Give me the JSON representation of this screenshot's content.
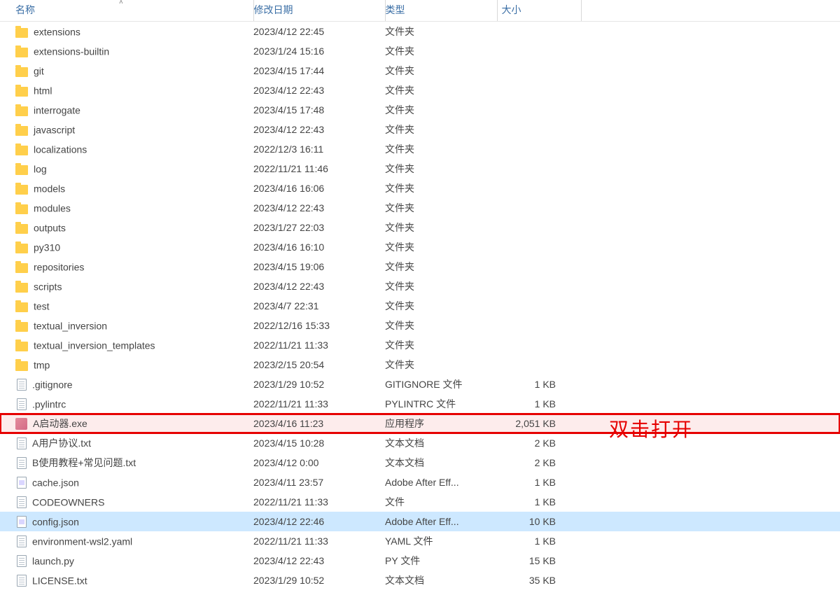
{
  "columns": {
    "name": "名称",
    "date": "修改日期",
    "type": "类型",
    "size": "大小"
  },
  "annotation": "双击打开",
  "files": [
    {
      "icon": "folder",
      "name": "extensions",
      "date": "2023/4/12 22:45",
      "type": "文件夹",
      "size": ""
    },
    {
      "icon": "folder",
      "name": "extensions-builtin",
      "date": "2023/1/24 15:16",
      "type": "文件夹",
      "size": ""
    },
    {
      "icon": "folder",
      "name": "git",
      "date": "2023/4/15 17:44",
      "type": "文件夹",
      "size": ""
    },
    {
      "icon": "folder",
      "name": "html",
      "date": "2023/4/12 22:43",
      "type": "文件夹",
      "size": ""
    },
    {
      "icon": "folder",
      "name": "interrogate",
      "date": "2023/4/15 17:48",
      "type": "文件夹",
      "size": ""
    },
    {
      "icon": "folder",
      "name": "javascript",
      "date": "2023/4/12 22:43",
      "type": "文件夹",
      "size": ""
    },
    {
      "icon": "folder",
      "name": "localizations",
      "date": "2022/12/3 16:11",
      "type": "文件夹",
      "size": ""
    },
    {
      "icon": "folder",
      "name": "log",
      "date": "2022/11/21 11:46",
      "type": "文件夹",
      "size": ""
    },
    {
      "icon": "folder",
      "name": "models",
      "date": "2023/4/16 16:06",
      "type": "文件夹",
      "size": ""
    },
    {
      "icon": "folder",
      "name": "modules",
      "date": "2023/4/12 22:43",
      "type": "文件夹",
      "size": ""
    },
    {
      "icon": "folder",
      "name": "outputs",
      "date": "2023/1/27 22:03",
      "type": "文件夹",
      "size": ""
    },
    {
      "icon": "folder",
      "name": "py310",
      "date": "2023/4/16 16:10",
      "type": "文件夹",
      "size": ""
    },
    {
      "icon": "folder",
      "name": "repositories",
      "date": "2023/4/15 19:06",
      "type": "文件夹",
      "size": ""
    },
    {
      "icon": "folder",
      "name": "scripts",
      "date": "2023/4/12 22:43",
      "type": "文件夹",
      "size": ""
    },
    {
      "icon": "folder",
      "name": "test",
      "date": "2023/4/7 22:31",
      "type": "文件夹",
      "size": ""
    },
    {
      "icon": "folder",
      "name": "textual_inversion",
      "date": "2022/12/16 15:33",
      "type": "文件夹",
      "size": ""
    },
    {
      "icon": "folder",
      "name": "textual_inversion_templates",
      "date": "2022/11/21 11:33",
      "type": "文件夹",
      "size": ""
    },
    {
      "icon": "folder",
      "name": "tmp",
      "date": "2023/2/15 20:54",
      "type": "文件夹",
      "size": ""
    },
    {
      "icon": "file",
      "name": ".gitignore",
      "date": "2023/1/29 10:52",
      "type": "GITIGNORE 文件",
      "size": "1 KB"
    },
    {
      "icon": "file",
      "name": ".pylintrc",
      "date": "2022/11/21 11:33",
      "type": "PYLINTRC 文件",
      "size": "1 KB"
    },
    {
      "icon": "exe",
      "name": "A启动器.exe",
      "date": "2023/4/16 11:23",
      "type": "应用程序",
      "size": "2,051 KB",
      "highlighted": true
    },
    {
      "icon": "file",
      "name": "A用户协议.txt",
      "date": "2023/4/15 10:28",
      "type": "文本文档",
      "size": "2 KB"
    },
    {
      "icon": "file",
      "name": "B使用教程+常见问题.txt",
      "date": "2023/4/12 0:00",
      "type": "文本文档",
      "size": "2 KB"
    },
    {
      "icon": "json",
      "name": "cache.json",
      "date": "2023/4/11 23:57",
      "type": "Adobe After Eff...",
      "size": "1 KB"
    },
    {
      "icon": "file",
      "name": "CODEOWNERS",
      "date": "2022/11/21 11:33",
      "type": "文件",
      "size": "1 KB"
    },
    {
      "icon": "json",
      "name": "config.json",
      "date": "2023/4/12 22:46",
      "type": "Adobe After Eff...",
      "size": "10 KB",
      "selected": true
    },
    {
      "icon": "file",
      "name": "environment-wsl2.yaml",
      "date": "2022/11/21 11:33",
      "type": "YAML 文件",
      "size": "1 KB"
    },
    {
      "icon": "file",
      "name": "launch.py",
      "date": "2023/4/12 22:43",
      "type": "PY 文件",
      "size": "15 KB"
    },
    {
      "icon": "file",
      "name": "LICENSE.txt",
      "date": "2023/1/29 10:52",
      "type": "文本文档",
      "size": "35 KB"
    }
  ]
}
